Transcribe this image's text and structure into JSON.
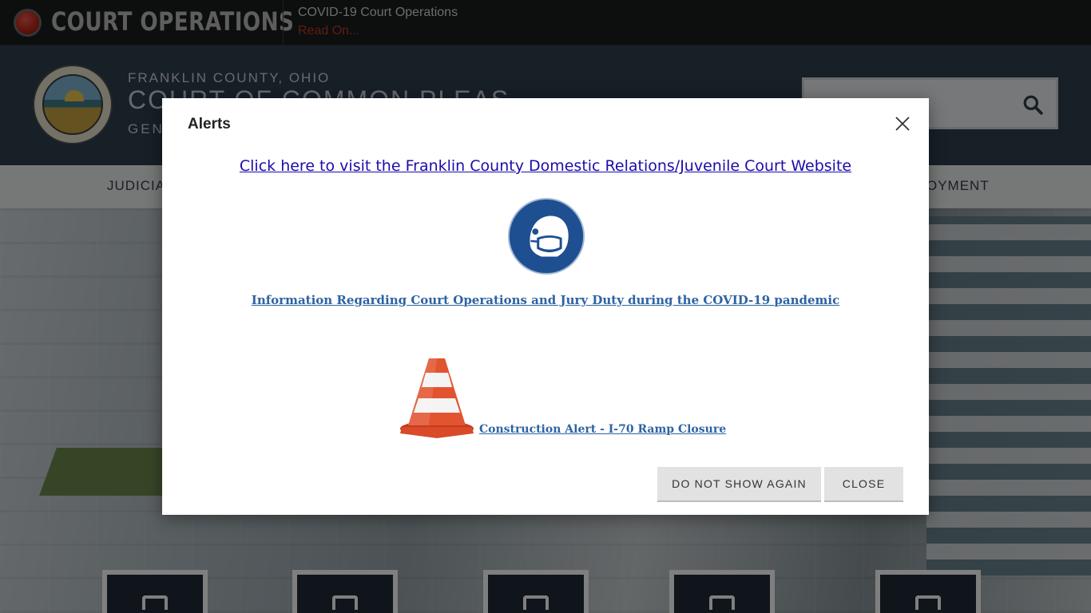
{
  "ops_bar": {
    "title": "COURT OPERATIONS",
    "alert_title": "COVID-19 Court Operations",
    "alert_link": "Read On..."
  },
  "header": {
    "county": "FRANKLIN COUNTY, OHIO",
    "court": "COURT OF COMMON PLEAS",
    "division": "GEN",
    "seal_top_text": "COMMON PLEAS COURT",
    "seal_bottom_text": "FRANKLIN COUNTY OHIO"
  },
  "search": {
    "placeholder": "",
    "icon": "search-icon"
  },
  "nav": {
    "items": [
      "JUDICIA",
      "OYMENT"
    ]
  },
  "modal": {
    "title": "Alerts",
    "main_link": "Click here to visit the Franklin County Domestic Relations/Juvenile Court Website",
    "covid_link": "Information Regarding Court Operations and Jury Duty during the COVID-19 pandemic",
    "construction_link": "Construction Alert - I-70 Ramp Closure",
    "buttons": {
      "dont_show": "DO NOT SHOW AGAIN",
      "close": "CLOSE"
    },
    "icons": [
      "close-icon",
      "face-mask-icon",
      "traffic-cone-icon"
    ]
  },
  "colors": {
    "ops_bar_bg": "#1b1c1d",
    "header_bg": "#2f3f4f",
    "alert_red": "#c0392b",
    "link_blue": "#1a0dab",
    "alert_link_blue": "#2e63a3",
    "mask_blue": "#1d4f91"
  }
}
